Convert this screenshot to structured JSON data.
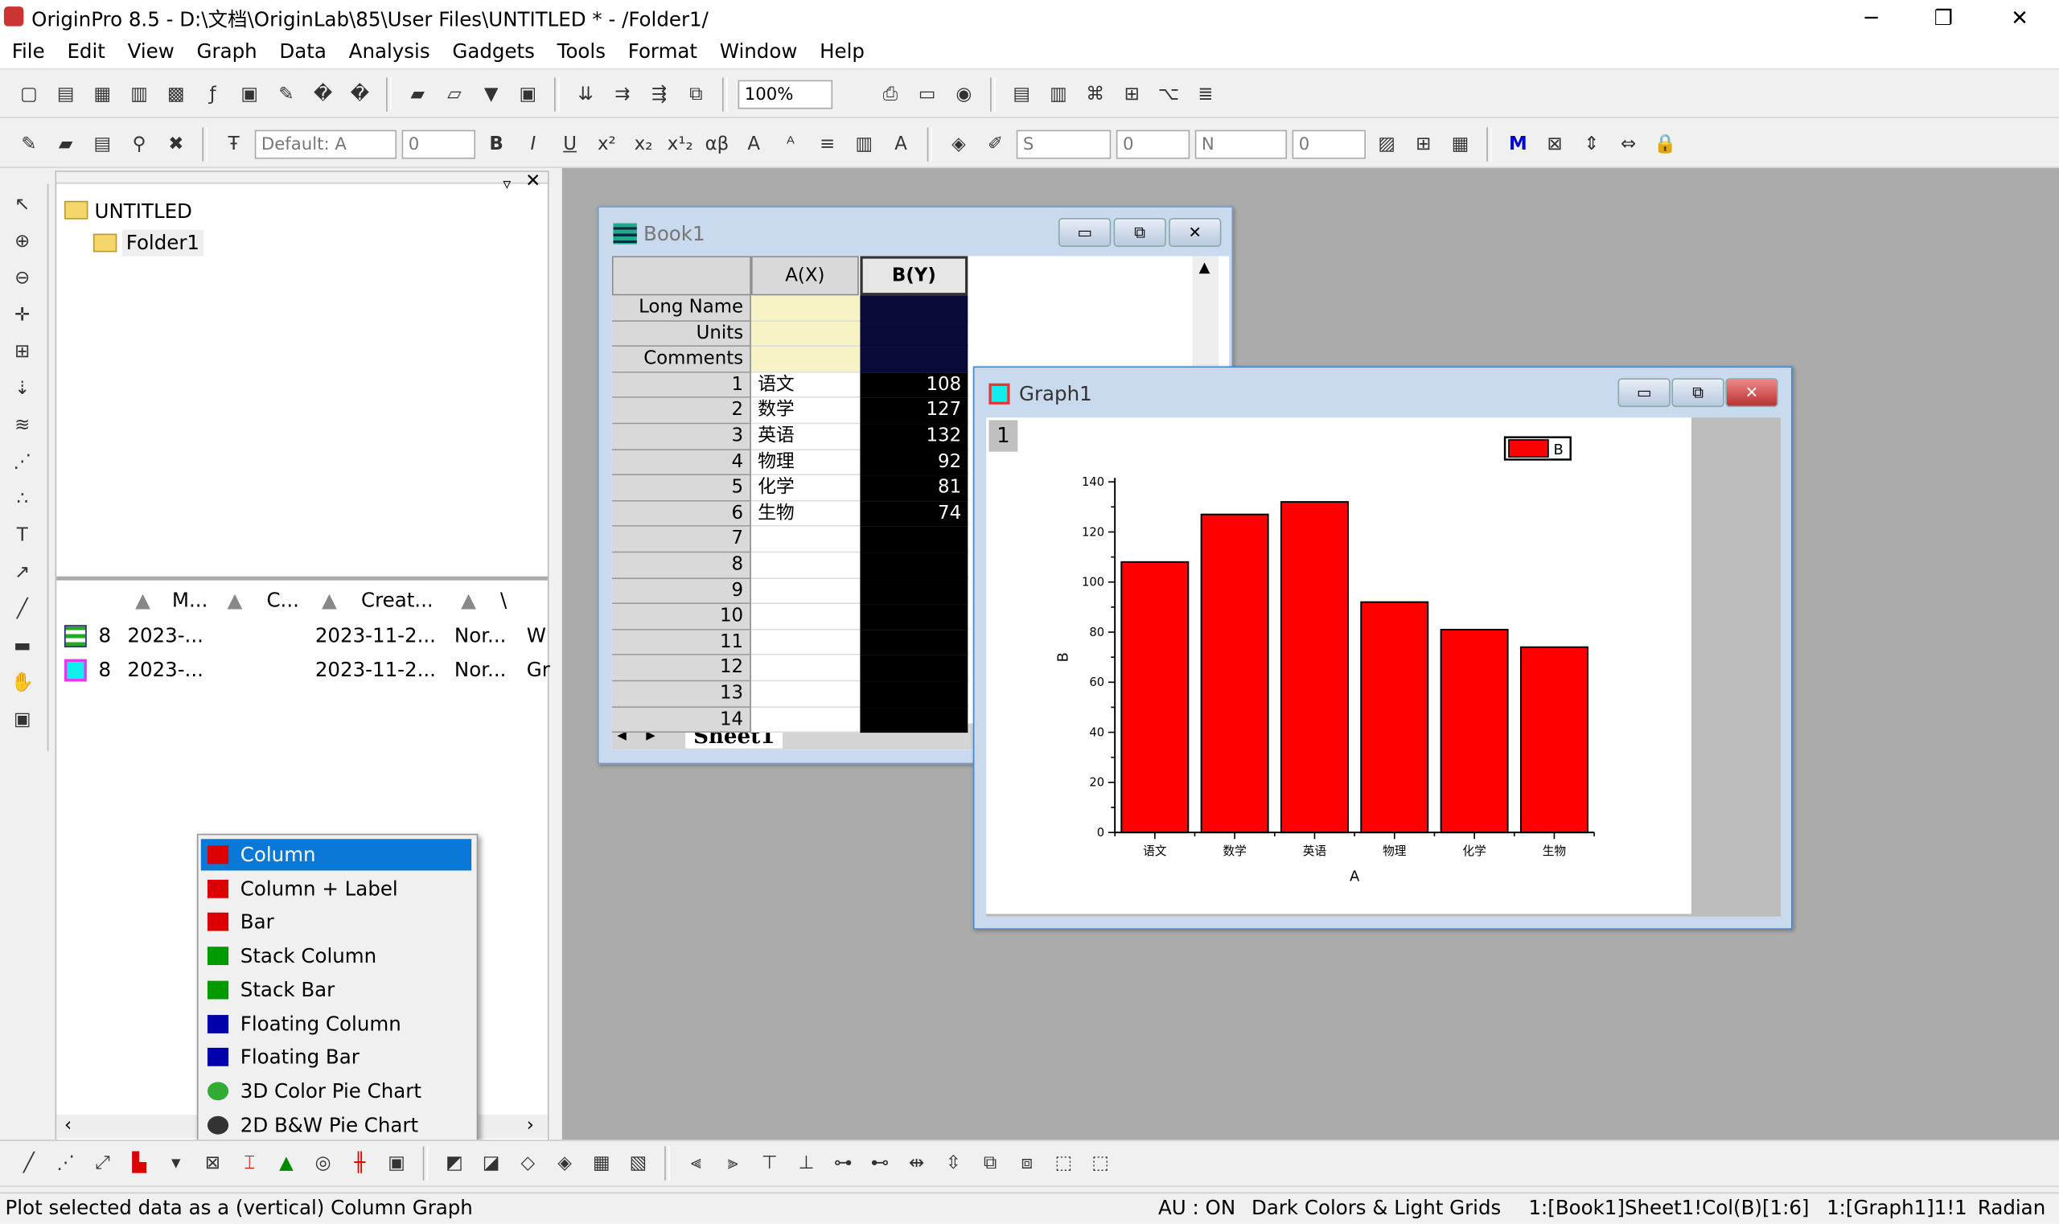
{
  "app": {
    "title": "OriginPro 8.5 - D:\\文档\\OriginLab\\85\\User Files\\UNTITLED * - /Folder1/"
  },
  "menu": [
    "File",
    "Edit",
    "View",
    "Graph",
    "Data",
    "Analysis",
    "Gadgets",
    "Tools",
    "Format",
    "Window",
    "Help"
  ],
  "toolbar1": {
    "zoom": "100%",
    "icons": [
      "new-project",
      "new-workbook",
      "new-excel",
      "new-graph",
      "new-matrix",
      "new-function",
      "new-layout",
      "new-notes",
      "open",
      "open-template",
      "open-excel",
      "save",
      "save-template",
      "import-ascii",
      "import-multiple",
      "import-wizard",
      "duplicate",
      "refresh",
      "zoom-combo",
      "print",
      "export",
      "slideshow",
      "code-builder",
      "results-log",
      "project-explorer",
      "layout",
      "command-window",
      "script",
      "add-column"
    ]
  },
  "toolbar2": {
    "font": "Default: A",
    "size": "0",
    "bold": "B",
    "italic": "I",
    "underline": "U",
    "line_style": "S",
    "line_width": "0",
    "fill_pattern": "N",
    "fill_width": "0"
  },
  "project": {
    "root": "UNTITLED",
    "folder": "Folder1",
    "columns": [
      "M...",
      "C...",
      "Creat...",
      "\\"
    ],
    "rows": [
      {
        "icon": "workbook-icon",
        "a": "8",
        "modified": "2023-...",
        "created": "2023-11-2...",
        "state": "Nor...",
        "type": "W"
      },
      {
        "icon": "graph-icon",
        "a": "8",
        "modified": "2023-...",
        "created": "2023-11-2...",
        "state": "Nor...",
        "type": "Gr"
      }
    ]
  },
  "book": {
    "title": "Book1",
    "colA": "A(X)",
    "colB": "B(Y)",
    "labels": [
      "Long Name",
      "Units",
      "Comments"
    ],
    "rows": [
      [
        "1",
        "语文",
        "108"
      ],
      [
        "2",
        "数学",
        "127"
      ],
      [
        "3",
        "英语",
        "132"
      ],
      [
        "4",
        "物理",
        "92"
      ],
      [
        "5",
        "化学",
        "81"
      ],
      [
        "6",
        "生物",
        "74"
      ],
      [
        "7",
        "",
        ""
      ],
      [
        "8",
        "",
        ""
      ],
      [
        "9",
        "",
        ""
      ],
      [
        "10",
        "",
        ""
      ],
      [
        "11",
        "",
        ""
      ],
      [
        "12",
        "",
        ""
      ],
      [
        "13",
        "",
        ""
      ],
      [
        "14",
        "",
        ""
      ]
    ],
    "sheet": "Sheet1"
  },
  "graph": {
    "title": "Graph1",
    "layer": "1"
  },
  "chart_data": {
    "type": "bar",
    "categories": [
      "语文",
      "数学",
      "英语",
      "物理",
      "化学",
      "生物"
    ],
    "series": [
      {
        "name": "B",
        "values": [
          108,
          127,
          132,
          92,
          81,
          74
        ],
        "color": "#ff0000"
      }
    ],
    "xlabel": "A",
    "ylabel": "B",
    "ylim": [
      0,
      140
    ],
    "yticks": [
      0,
      20,
      40,
      60,
      80,
      100,
      120,
      140
    ],
    "legend": "top-right",
    "grid": false
  },
  "context_menu": {
    "items": [
      {
        "label": "Column",
        "icon": "column-icon"
      },
      {
        "label": "Column + Label",
        "icon": "column-label-icon"
      },
      {
        "label": "Bar",
        "icon": "bar-icon"
      },
      {
        "label": "Stack Column",
        "icon": "stack-column-icon"
      },
      {
        "label": "Stack Bar",
        "icon": "stack-bar-icon"
      },
      {
        "label": "Floating Column",
        "icon": "floating-column-icon"
      },
      {
        "label": "Floating Bar",
        "icon": "floating-bar-icon"
      },
      {
        "label": "3D Color Pie Chart",
        "icon": "pie-3d-icon"
      },
      {
        "label": "2D B&W Pie Chart",
        "icon": "pie-2d-icon"
      }
    ],
    "selected": 0
  },
  "status": {
    "hint": "Plot selected data as a (vertical) Column Graph",
    "au": "AU : ON",
    "theme": "Dark Colors & Light Grids",
    "range": "1:[Book1]Sheet1!Col(B)[1:6]",
    "graph": "1:[Graph1]1!1",
    "angle": "Radian"
  }
}
